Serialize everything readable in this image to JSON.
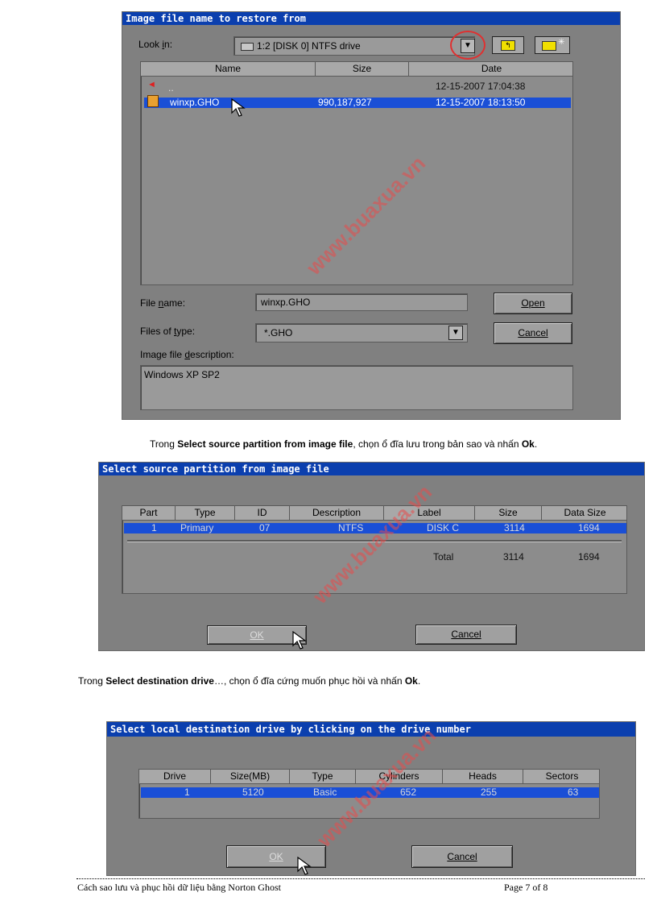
{
  "dialog1": {
    "title": "Image file name to restore from",
    "look_in_label": "Look in:",
    "look_in_value": "1:2 [DISK 0] NTFS drive",
    "columns": [
      "Name",
      "Size",
      "Date"
    ],
    "rows": [
      {
        "name": "..",
        "size": "",
        "date": "12-15-2007 17:04:38"
      },
      {
        "name": "winxp.GHO",
        "size": "990,187,927",
        "date": "12-15-2007 18:13:50"
      }
    ],
    "file_name_label": "File name:",
    "file_name_value": "winxp.GHO",
    "files_of_type_label": "Files of type:",
    "files_of_type_value": "*.GHO",
    "description_label": "Image file description:",
    "description_value": "Windows XP SP2",
    "open_label": "Open",
    "cancel_label": "Cancel"
  },
  "para1": {
    "prefix": "Trong ",
    "bold": "Select source partition from image file",
    "suffix": ", chọn ổ đĩa lưu trong bản sao và nhấn ",
    "ok": "Ok",
    "end": "."
  },
  "dialog2": {
    "title": "Select source partition from image file",
    "columns": [
      "Part",
      "Type",
      "ID",
      "Description",
      "Label",
      "Size",
      "Data Size"
    ],
    "row": [
      "1",
      "Primary",
      "07",
      "NTFS",
      "DISK C",
      "3114",
      "1694"
    ],
    "total_label": "Total",
    "total_size": "3114",
    "total_data_size": "1694",
    "ok_label": "OK",
    "cancel_label": "Cancel"
  },
  "para2": {
    "prefix": "Trong ",
    "bold": "Select destination drive",
    "suffix": "…, chọn ổ đĩa cứng muốn phục hồi và nhấn ",
    "ok": "Ok",
    "end": "."
  },
  "dialog3": {
    "title": "Select local destination drive by clicking on the drive number",
    "columns": [
      "Drive",
      "Size(MB)",
      "Type",
      "Cylinders",
      "Heads",
      "Sectors"
    ],
    "row": [
      "1",
      "5120",
      "Basic",
      "652",
      "255",
      "63"
    ],
    "ok_label": "OK",
    "cancel_label": "Cancel"
  },
  "watermark": "www.buaxua.vn",
  "footer": {
    "title": "Cách sao lưu và phục hồi dữ liệu bằng Norton Ghost",
    "page": "Page 7 of 8"
  }
}
